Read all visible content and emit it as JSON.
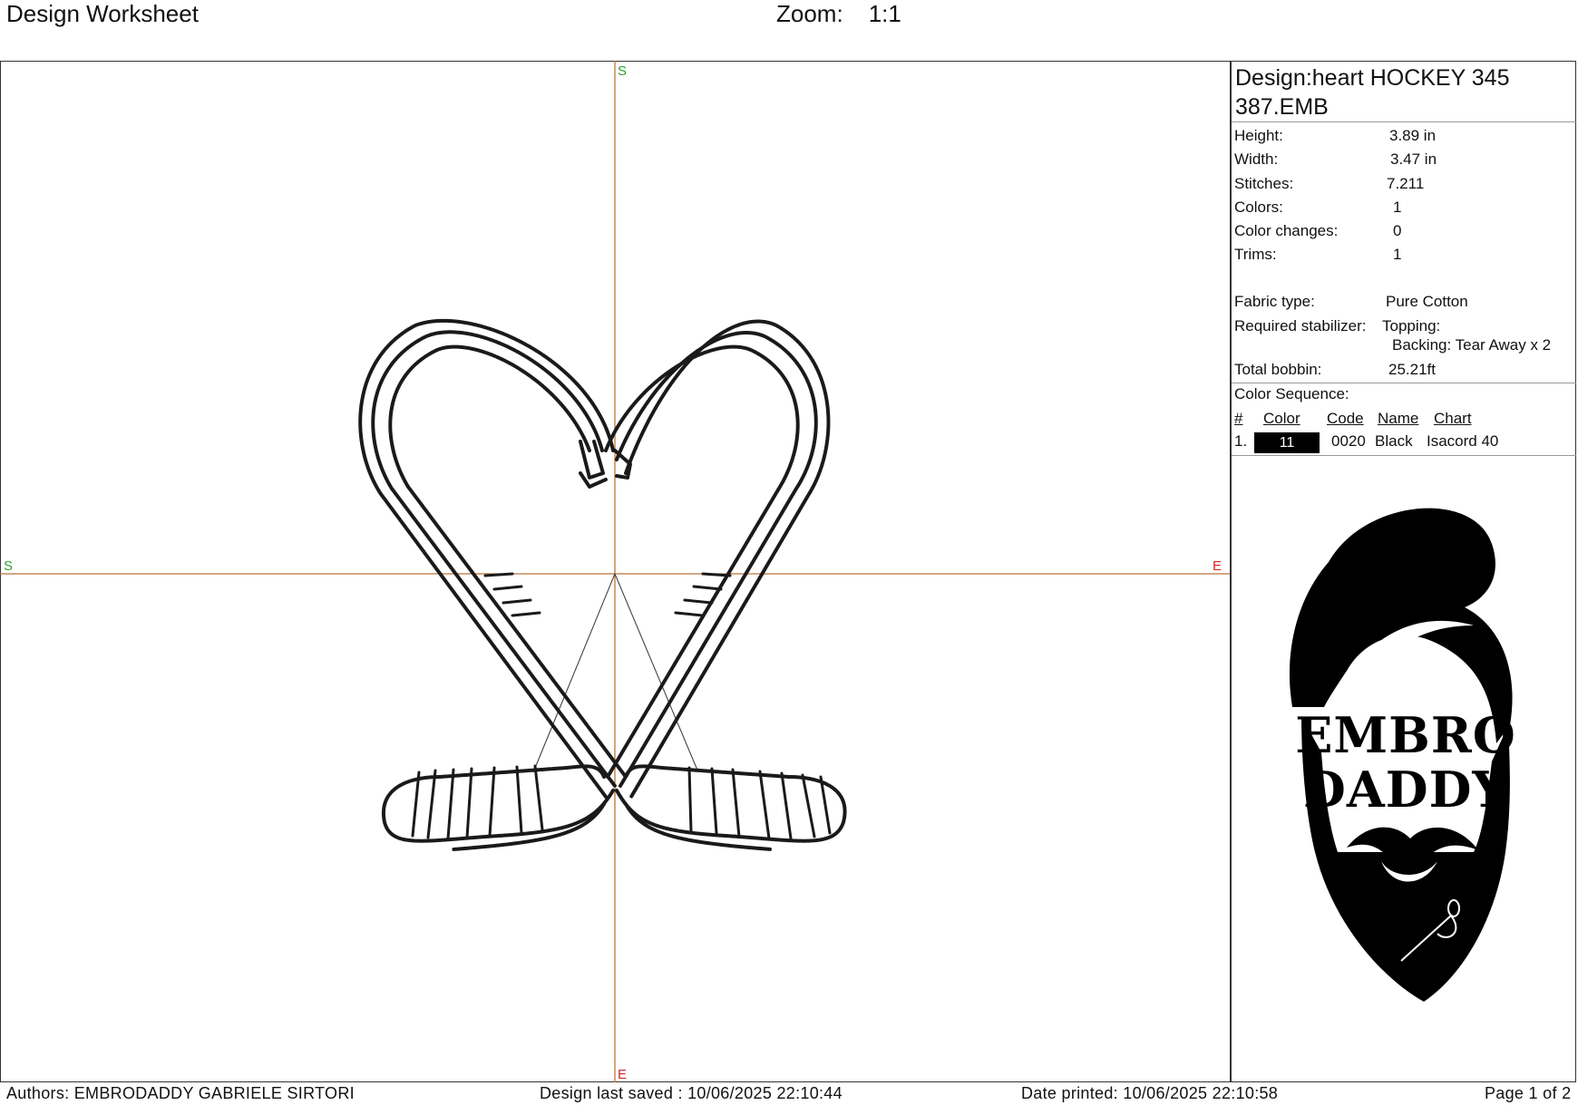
{
  "header": {
    "title": "Design Worksheet",
    "zoom_label": "Zoom:",
    "zoom_value": "1:1"
  },
  "axis_markers": {
    "top": "S",
    "left": "S",
    "right": "E",
    "bottom": "E"
  },
  "design": {
    "title": "Design:heart HOCKEY 345 387.EMB",
    "props": [
      {
        "label": "Height:",
        "value": "3.89 in"
      },
      {
        "label": "Width:",
        "value": "3.47 in"
      },
      {
        "label": "Stitches:",
        "value": "7.211"
      },
      {
        "label": "Colors:",
        "value": "1"
      },
      {
        "label": "Color changes:",
        "value": "0"
      },
      {
        "label": "Trims:",
        "value": "1"
      }
    ],
    "fabric_label": "Fabric type:",
    "fabric_value": "Pure Cotton",
    "stabilizer_label": "Required stabilizer:",
    "topping": "Topping:",
    "backing": "Backing: Tear Away x 2",
    "bobbin_label": "Total bobbin:",
    "bobbin_value": "25.21ft"
  },
  "color_sequence": {
    "title": "Color Sequence:",
    "headers": {
      "num": "#",
      "color": "Color",
      "code": "Code",
      "name": "Name",
      "chart": "Chart"
    },
    "rows": [
      {
        "num": "1.",
        "swatch": "11",
        "swatch_color": "#000000",
        "code": "0020",
        "name": "Black",
        "chart": "Isacord 40"
      }
    ]
  },
  "logo": {
    "line1": "EMBRO",
    "line2": "DADDY"
  },
  "footer": {
    "authors": "Authors: EMBRODADDY GABRIELE SIRTORI",
    "saved": "Design last saved : 10/06/2025 22:10:44",
    "printed": "Date printed: 10/06/2025 22:10:58",
    "page": "Page 1 of 2"
  },
  "colors": {
    "axis": "#b8753a",
    "marker_green": "#2ca02c",
    "marker_red": "#d62728",
    "stitch": "#1a1a1a"
  }
}
